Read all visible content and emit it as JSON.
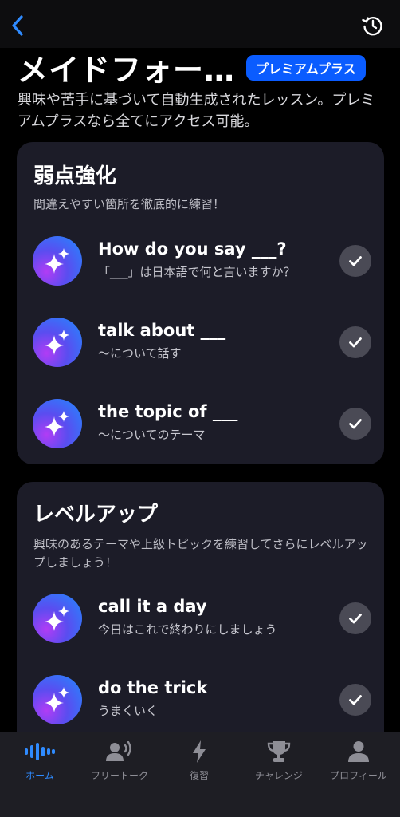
{
  "header": {
    "title": "メイドフォー…",
    "badge": "プレミアムプラス",
    "description": "興味や苦手に基づいて自動生成されたレッスン。プレミアムプラスなら全てにアクセス可能。"
  },
  "sections": [
    {
      "title": "弱点強化",
      "description": "間違えやすい箇所を徹底的に練習！",
      "lessons": [
        {
          "title": "How do you say ___?",
          "subtitle": "「___」は日本語で何と言いますか？",
          "completed": true
        },
        {
          "title": "talk about ___",
          "subtitle": "〜について話す",
          "completed": true
        },
        {
          "title": "the topic of ___",
          "subtitle": "〜についてのテーマ",
          "completed": true
        }
      ]
    },
    {
      "title": "レベルアップ",
      "description": "興味のあるテーマや上級トピックを練習してさらにレベルアップしましょう！",
      "lessons": [
        {
          "title": "call it a day",
          "subtitle": "今日はこれで終わりにしましょう",
          "completed": true
        },
        {
          "title": "do the trick",
          "subtitle": "うまくいく",
          "completed": true
        }
      ]
    }
  ],
  "tabbar": {
    "tabs": [
      {
        "label": "ホーム",
        "icon": "waveform-icon",
        "active": true
      },
      {
        "label": "フリートーク",
        "icon": "person-speaking-icon",
        "active": false
      },
      {
        "label": "復習",
        "icon": "bolt-icon",
        "active": false
      },
      {
        "label": "チャレンジ",
        "icon": "trophy-icon",
        "active": false
      },
      {
        "label": "プロフィール",
        "icon": "person-icon",
        "active": false
      }
    ]
  },
  "colors": {
    "background": "#000000",
    "card": "#1c1c28",
    "accent": "#2f8bff",
    "badge": "#0a5cff",
    "check": "#4a4a55"
  }
}
